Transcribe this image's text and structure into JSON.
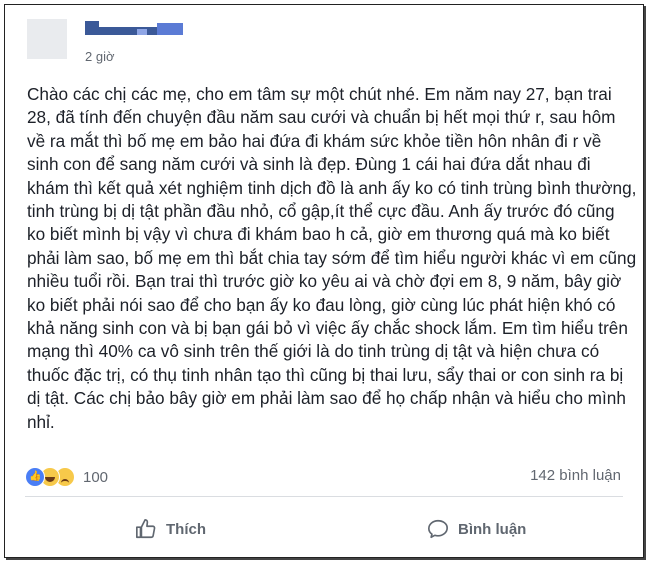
{
  "post": {
    "author_name": "",
    "timestamp": "2 giờ",
    "text": "Chào các chị các mẹ, cho em tâm sự một chút nhé. Em năm nay 27, bạn trai 28, đã tính đến chuyện đầu năm sau cưới và chuẩn bị hết mọi thứ r, sau hôm về ra mắt thì bố mẹ em bảo hai đứa đi khám sức khỏe tiền hôn nhân đi r về sinh con để sang năm cưới và sinh là đẹp. Đùng 1 cái hai đứa dắt nhau đi khám thì kết quả xét nghiệm tinh dịch đồ là anh ấy ko có tinh trùng bình thường, tinh trùng bị dị tật phần đầu nhỏ, cổ gập,ít thể cực đầu. Anh ấy trước đó cũng ko biết mình bị vậy vì chưa đi khám bao h cả, giờ em thương quá mà ko biết phải làm sao, bố mẹ em thì bắt chia tay sớm để tìm hiểu người khác vì em cũng nhiều tuổi rồi. Bạn trai thì trước giờ ko yêu ai và chờ đợi em 8, 9 năm, bây giờ ko biết phải nói sao để cho bạn ấy ko đau lòng, giờ cùng lúc phát hiện khó có khả năng sinh con và bị bạn gái bỏ vì việc ấy chắc shock lắm. Em tìm hiểu trên mạng thì 40% ca vô sinh trên thế giới là do tinh trùng dị tật và hiện chưa có thuốc đặc trị, có thụ tinh nhân tạo thì cũng bị thai lưu, sẩy thai or con sinh ra bị dị tật. Các chị bảo bây giờ em phải làm sao để họ chấp nhận và hiểu cho mình nhỉ."
  },
  "reactions": {
    "icons": [
      "like-icon",
      "haha-icon",
      "sad-icon"
    ],
    "count": "100"
  },
  "comments": {
    "count_label": "142 bình luận"
  },
  "actions": {
    "like_label": "Thích",
    "comment_label": "Bình luận"
  },
  "colors": {
    "brand": "#3b5998",
    "text": "#1d2129",
    "muted": "#616770"
  }
}
